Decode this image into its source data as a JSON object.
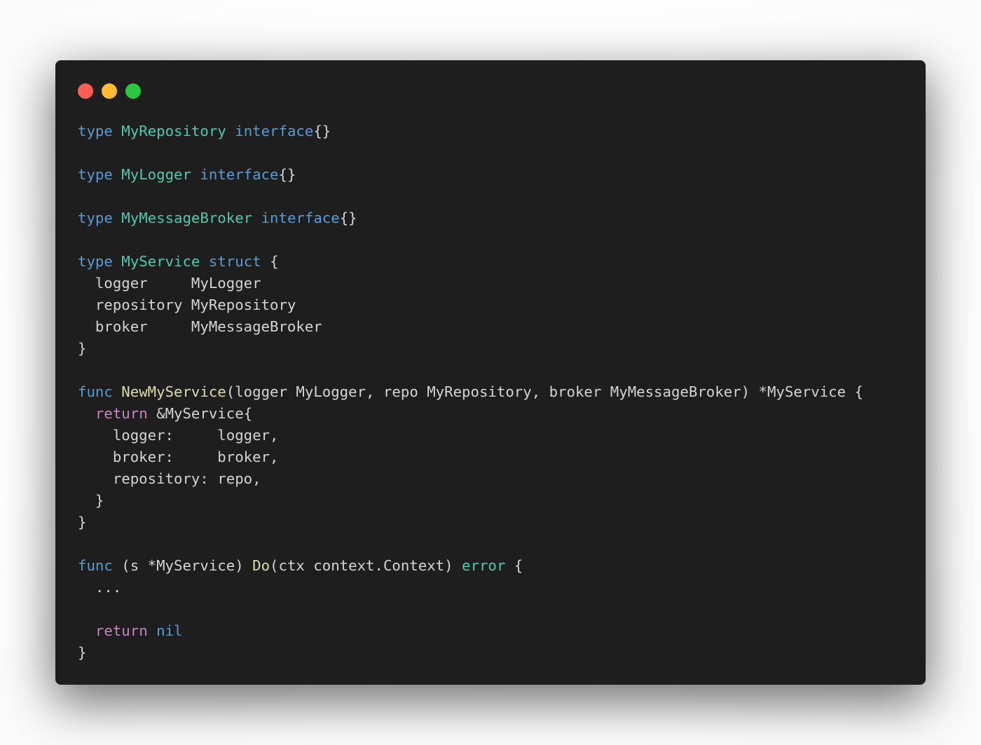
{
  "window": {
    "controls": {
      "close_color": "#ff5f57",
      "minimize_color": "#febc2e",
      "zoom_color": "#28c840"
    }
  },
  "code": {
    "language": "go",
    "lines": [
      [
        {
          "t": "type",
          "c": "kw"
        },
        {
          "t": " "
        },
        {
          "t": "MyRepository",
          "c": "ty"
        },
        {
          "t": " "
        },
        {
          "t": "interface",
          "c": "kw"
        },
        {
          "t": "{}"
        }
      ],
      [],
      [
        {
          "t": "type",
          "c": "kw"
        },
        {
          "t": " "
        },
        {
          "t": "MyLogger",
          "c": "ty"
        },
        {
          "t": " "
        },
        {
          "t": "interface",
          "c": "kw"
        },
        {
          "t": "{}"
        }
      ],
      [],
      [
        {
          "t": "type",
          "c": "kw"
        },
        {
          "t": " "
        },
        {
          "t": "MyMessageBroker",
          "c": "ty"
        },
        {
          "t": " "
        },
        {
          "t": "interface",
          "c": "kw"
        },
        {
          "t": "{}"
        }
      ],
      [],
      [
        {
          "t": "type",
          "c": "kw"
        },
        {
          "t": " "
        },
        {
          "t": "MyService",
          "c": "ty"
        },
        {
          "t": " "
        },
        {
          "t": "struct",
          "c": "kw"
        },
        {
          "t": " {"
        }
      ],
      [
        {
          "t": "  logger     MyLogger"
        }
      ],
      [
        {
          "t": "  repository MyRepository"
        }
      ],
      [
        {
          "t": "  broker     MyMessageBroker"
        }
      ],
      [
        {
          "t": "}"
        }
      ],
      [],
      [
        {
          "t": "func",
          "c": "kw"
        },
        {
          "t": " "
        },
        {
          "t": "NewMyService",
          "c": "fn"
        },
        {
          "t": "(logger MyLogger, repo MyRepository, broker MyMessageBroker) *MyService {"
        }
      ],
      [
        {
          "t": "  "
        },
        {
          "t": "return",
          "c": "ctl"
        },
        {
          "t": " &MyService{"
        }
      ],
      [
        {
          "t": "    logger:     logger,"
        }
      ],
      [
        {
          "t": "    broker:     broker,"
        }
      ],
      [
        {
          "t": "    repository: repo,"
        }
      ],
      [
        {
          "t": "  }"
        }
      ],
      [
        {
          "t": "}"
        }
      ],
      [],
      [
        {
          "t": "func",
          "c": "kw"
        },
        {
          "t": " (s *MyService) "
        },
        {
          "t": "Do",
          "c": "fn"
        },
        {
          "t": "(ctx context.Context) "
        },
        {
          "t": "error",
          "c": "ty"
        },
        {
          "t": " {"
        }
      ],
      [
        {
          "t": "  ..."
        }
      ],
      [],
      [
        {
          "t": "  "
        },
        {
          "t": "return",
          "c": "ctl"
        },
        {
          "t": " "
        },
        {
          "t": "nil",
          "c": "kw"
        }
      ],
      [
        {
          "t": "}"
        }
      ]
    ]
  }
}
